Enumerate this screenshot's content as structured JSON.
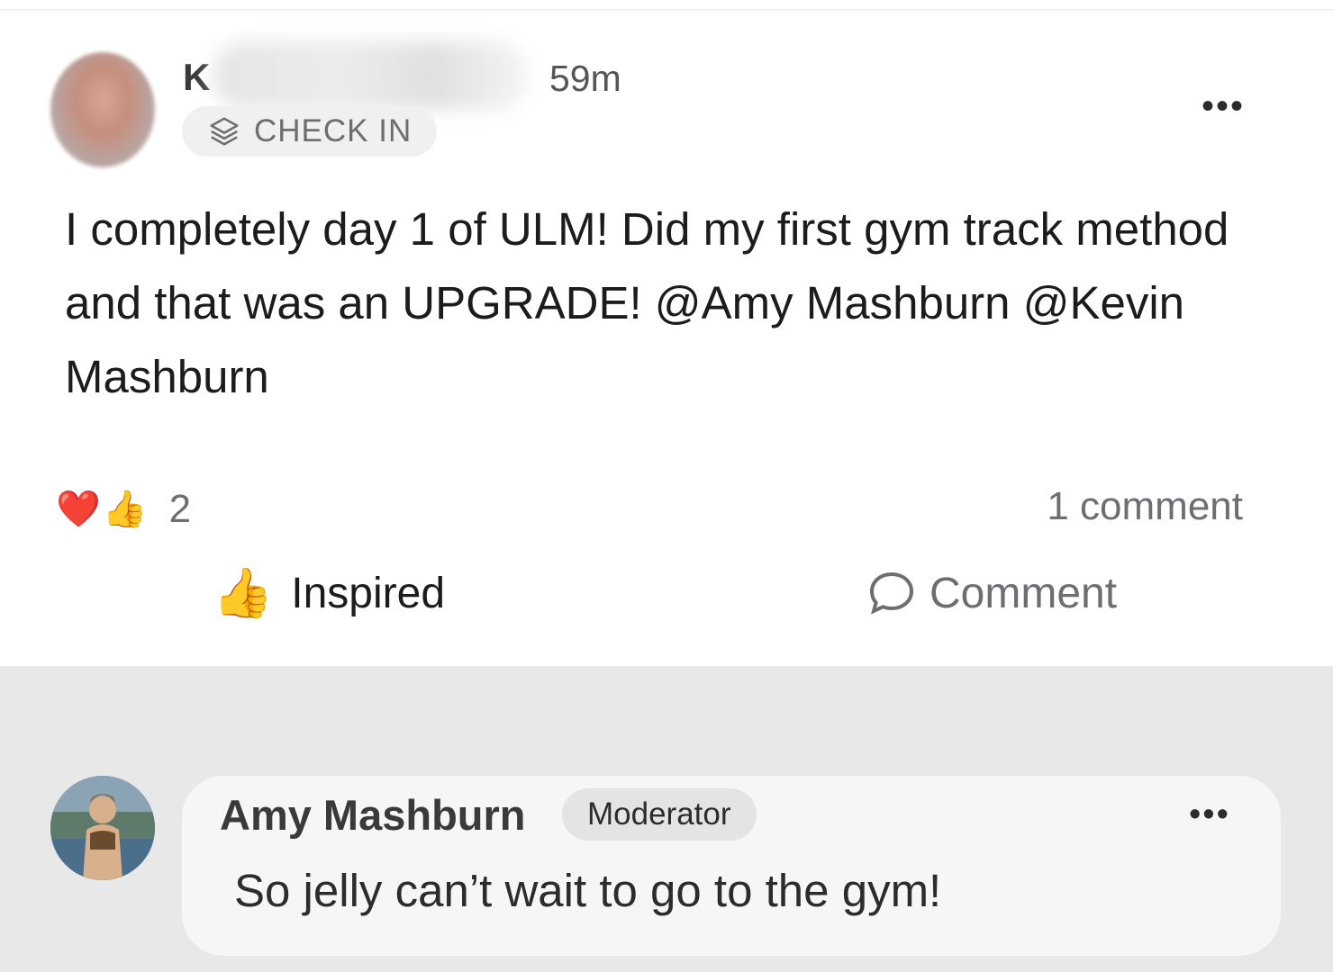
{
  "post": {
    "author_initial": "K",
    "timestamp": "59m",
    "more_icon": "•••",
    "tag": {
      "icon": "layers-icon",
      "label": "CHECK IN"
    },
    "body": "I completely day 1 of ULM! Did my first gym track method and that was an UPGRADE! @Amy Mashburn @Kevin Mashburn",
    "reactions": {
      "icons": [
        "❤️",
        "👍"
      ],
      "count": "2"
    },
    "comment_count": "1 comment",
    "actions": {
      "inspired_icon": "👍",
      "inspired_label": "Inspired",
      "comment_icon": "speech-bubble-icon",
      "comment_label": "Comment"
    }
  },
  "comment": {
    "author": "Amy Mashburn",
    "badge": "Moderator",
    "more_icon": "•••",
    "text": "So jelly can’t wait to go to the gym!"
  },
  "colors": {
    "background": "#ffffff",
    "comments_background": "#e8e8e8",
    "bubble": "#f6f6f6",
    "heart": "#e0182c",
    "muted_text": "#6d6d72"
  }
}
